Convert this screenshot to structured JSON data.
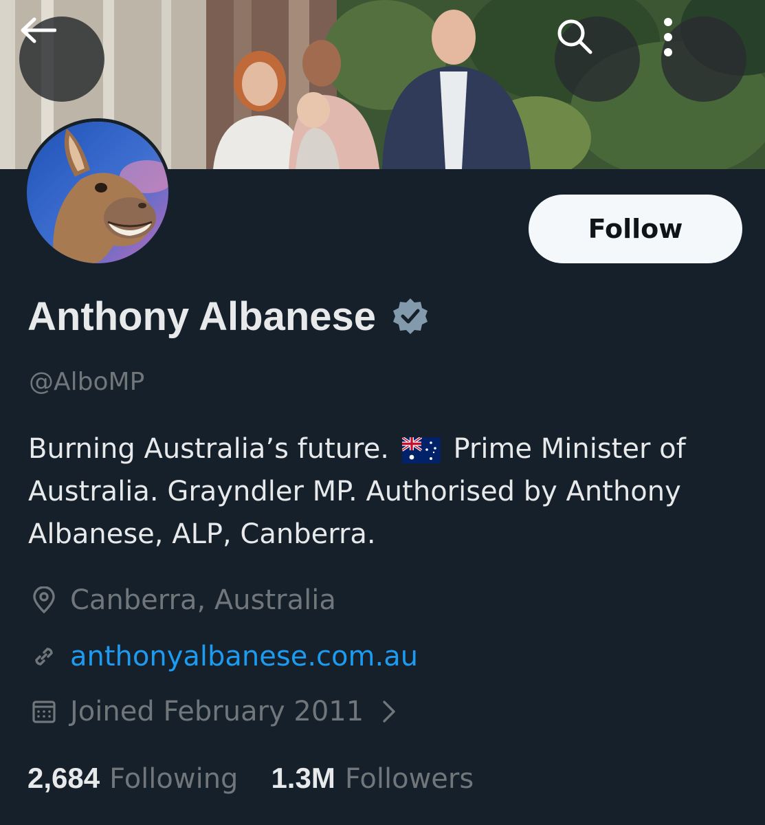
{
  "header": {
    "back_icon": "arrow-left-icon",
    "search_icon": "search-icon",
    "more_icon": "more-vertical-icon"
  },
  "profile": {
    "follow_label": "Follow",
    "name": "Anthony Albanese",
    "verified_icon": "verified-badge-icon",
    "handle": "@AlboMP",
    "bio_part1": "Burning Australia’s future.",
    "bio_flag": "australia-flag-icon",
    "bio_part2": "Prime Minister of Australia. Grayndler MP. Authorised by Anthony Albanese, ALP, Canberra.",
    "location": "Canberra, Australia",
    "location_icon": "location-pin-icon",
    "website": "anthonyalbanese.com.au",
    "link_icon": "link-icon",
    "joined": "Joined February 2011",
    "calendar_icon": "calendar-icon",
    "joined_chevron": "chevron-right-icon"
  },
  "stats": {
    "following_count": "2,684",
    "following_label": "Following",
    "followers_count": "1.3M",
    "followers_label": "Followers"
  },
  "colors": {
    "background": "#15202b",
    "primary_text": "#e7e9ea",
    "secondary_text": "#71767b",
    "link": "#1d9bf0",
    "follow_button": "#f5f8fa"
  }
}
